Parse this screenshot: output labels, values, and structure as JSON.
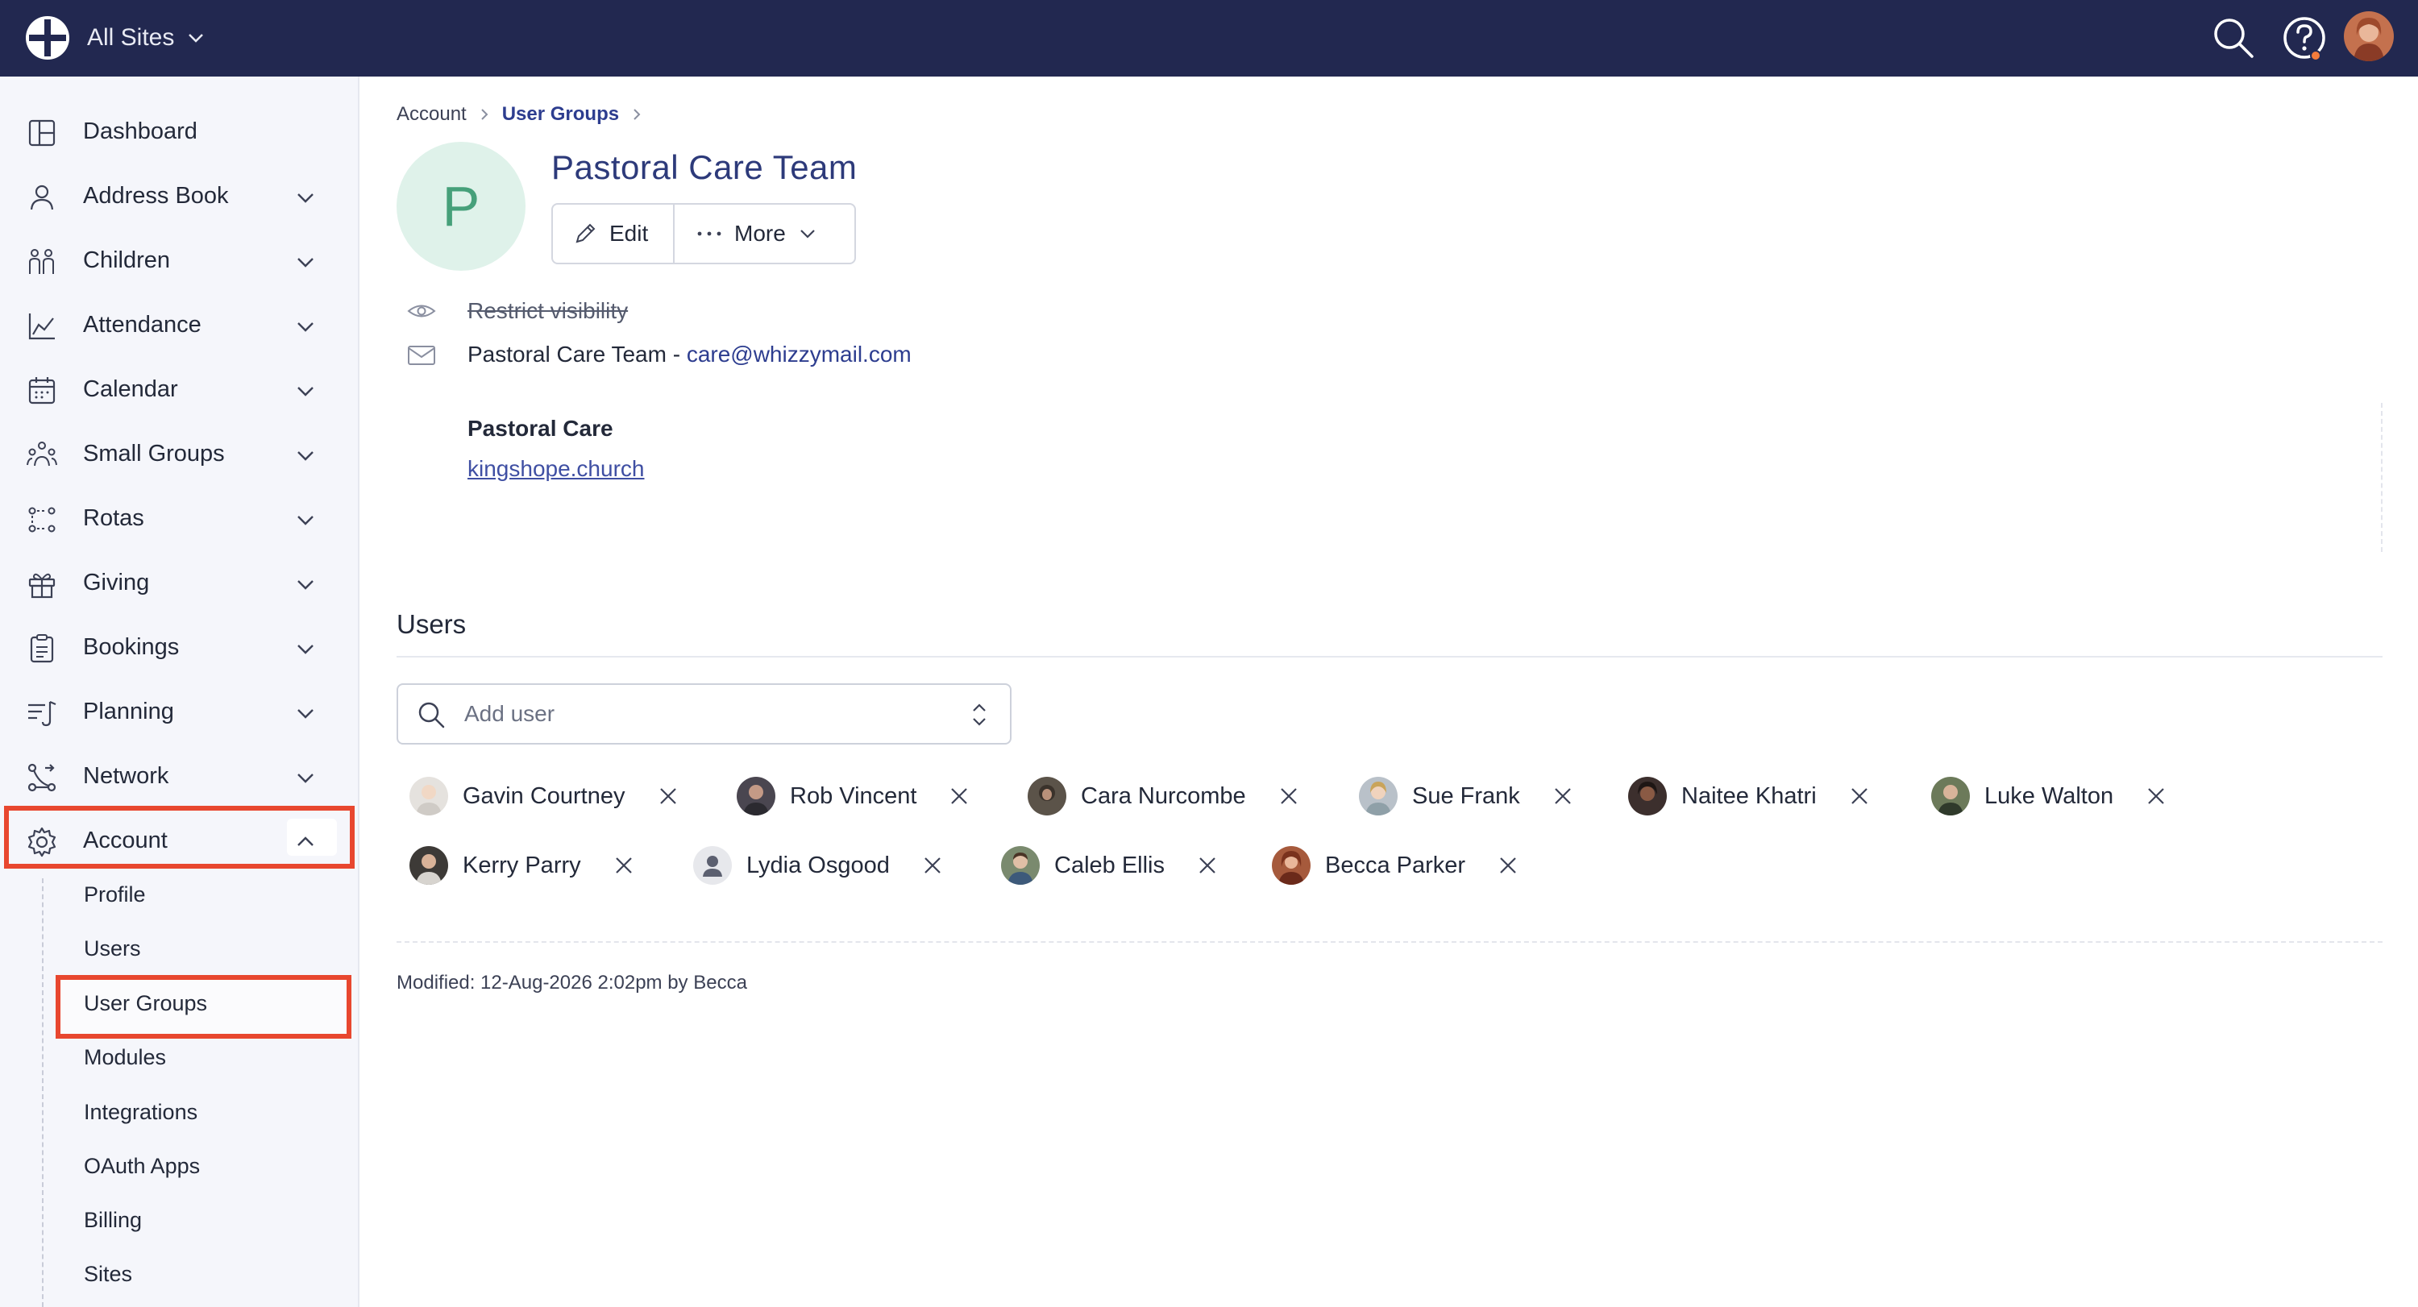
{
  "topbar": {
    "site_label": "All Sites",
    "icons": [
      "logo-icon",
      "search-icon",
      "help-icon",
      "user-avatar"
    ],
    "colors": {
      "background": "#222850",
      "notification": "#f47c3c"
    }
  },
  "sidebar": {
    "items": [
      {
        "label": "Dashboard",
        "icon": "dashboard-icon"
      },
      {
        "label": "Address Book",
        "icon": "person-icon"
      },
      {
        "label": "Children",
        "icon": "children-icon"
      },
      {
        "label": "Attendance",
        "icon": "attendance-chart-icon"
      },
      {
        "label": "Calendar",
        "icon": "calendar-icon"
      },
      {
        "label": "Small Groups",
        "icon": "groups-icon"
      },
      {
        "label": "Rotas",
        "icon": "rotas-icon"
      },
      {
        "label": "Giving",
        "icon": "gift-icon"
      },
      {
        "label": "Bookings",
        "icon": "clipboard-icon"
      },
      {
        "label": "Planning",
        "icon": "planning-icon"
      },
      {
        "label": "Network",
        "icon": "network-icon"
      },
      {
        "label": "Account",
        "icon": "gear-icon"
      }
    ],
    "account_subitems": [
      "Profile",
      "Users",
      "User Groups",
      "Modules",
      "Integrations",
      "OAuth Apps",
      "Billing",
      "Sites"
    ],
    "highlight_color": "#e8472f"
  },
  "breadcrumb": {
    "root": "Account",
    "current": "User Groups"
  },
  "group": {
    "avatar_letter": "P",
    "title": "Pastoral Care Team",
    "edit_label": "Edit",
    "more_label": "More",
    "restrict_label": "Restrict visibility",
    "email_prefix": "Pastoral Care Team - ",
    "email": "care@whizzymail.com",
    "detail_title": "Pastoral Care",
    "detail_link": "kingshope.church"
  },
  "users": {
    "heading": "Users",
    "add_placeholder": "Add user",
    "members": [
      {
        "name": "Gavin Courtney",
        "avatar_color": "#d9d4cf"
      },
      {
        "name": "Rob Vincent",
        "avatar_color": "#4a4650"
      },
      {
        "name": "Cara Nurcombe",
        "avatar_color": "#5b5349"
      },
      {
        "name": "Sue Frank",
        "avatar_color": "#b9c1c9"
      },
      {
        "name": "Naitee Khatri",
        "avatar_color": "#3c2f2d"
      },
      {
        "name": "Luke Walton",
        "avatar_color": "#6c7a5a"
      },
      {
        "name": "Kerry Parry",
        "avatar_color": "#3d3a37"
      },
      {
        "name": "Lydia Osgood",
        "avatar_color": "#e7e8ec"
      },
      {
        "name": "Caleb Ellis",
        "avatar_color": "#7a8a6e"
      },
      {
        "name": "Becca Parker",
        "avatar_color": "#a65a3c"
      }
    ]
  },
  "modified": "Modified: 12-Aug-2026 2:02pm by Becca"
}
